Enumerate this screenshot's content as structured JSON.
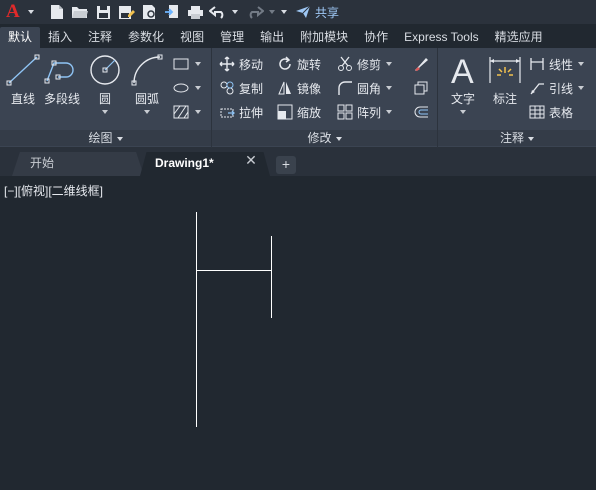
{
  "quick_access": {
    "icons": [
      "new-file-icon",
      "open-file-icon",
      "save-icon",
      "save-as-icon",
      "plot-preview-icon",
      "import-icon",
      "print-icon",
      "undo-icon",
      "redo-icon"
    ],
    "share_label": "共享"
  },
  "ribbon_tabs": [
    "默认",
    "插入",
    "注释",
    "参数化",
    "视图",
    "管理",
    "输出",
    "附加模块",
    "协作",
    "Express Tools",
    "精选应用"
  ],
  "active_tab": "默认",
  "panels": {
    "draw": {
      "title": "绘图",
      "tools": {
        "line": "直线",
        "polyline": "多段线",
        "circle": "圆",
        "arc": "圆弧"
      }
    },
    "modify": {
      "title": "修改",
      "tools": {
        "move": "移动",
        "rotate": "旋转",
        "trim": "修剪",
        "copy": "复制",
        "mirror": "镜像",
        "fillet": "圆角",
        "stretch": "拉伸",
        "scale": "缩放",
        "array": "阵列"
      }
    },
    "annotation": {
      "title": "注释",
      "tools": {
        "text": "文字",
        "dimension": "标注",
        "linear": "线性",
        "leader": "引线",
        "table": "表格"
      }
    }
  },
  "file_tabs": {
    "start": "开始",
    "drawing": "Drawing1*"
  },
  "viewport": {
    "label": "[−][俯视][二维线框]"
  },
  "colors": {
    "background": "#212830",
    "ribbon": "#3b4452",
    "accent_logo": "#e02a2a",
    "share": "#9ec7f4",
    "geometry": "#ffffff"
  }
}
